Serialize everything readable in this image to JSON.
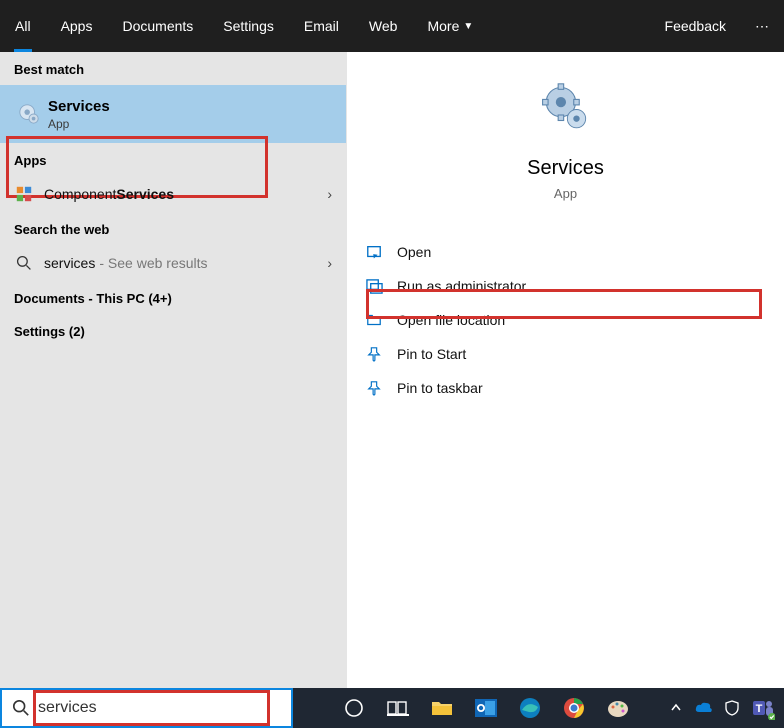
{
  "tabs": {
    "items": [
      "All",
      "Apps",
      "Documents",
      "Settings",
      "Email",
      "Web",
      "More"
    ],
    "feedback": "Feedback"
  },
  "left": {
    "best_match_heading": "Best match",
    "best": {
      "title": "Services",
      "sub": "App"
    },
    "apps_heading": "Apps",
    "component_prefix": "Component ",
    "component_bold": "Services",
    "search_web_heading": "Search the web",
    "web_query": "services",
    "web_suffix": " - See web results",
    "docs_heading": "Documents - This PC (4+)",
    "settings_heading": "Settings (2)"
  },
  "right": {
    "title": "Services",
    "sub": "App",
    "actions": {
      "open": "Open",
      "run_admin": "Run as administrator",
      "open_loc": "Open file location",
      "pin_start": "Pin to Start",
      "pin_taskbar": "Pin to taskbar"
    }
  },
  "search": {
    "value": "services"
  }
}
